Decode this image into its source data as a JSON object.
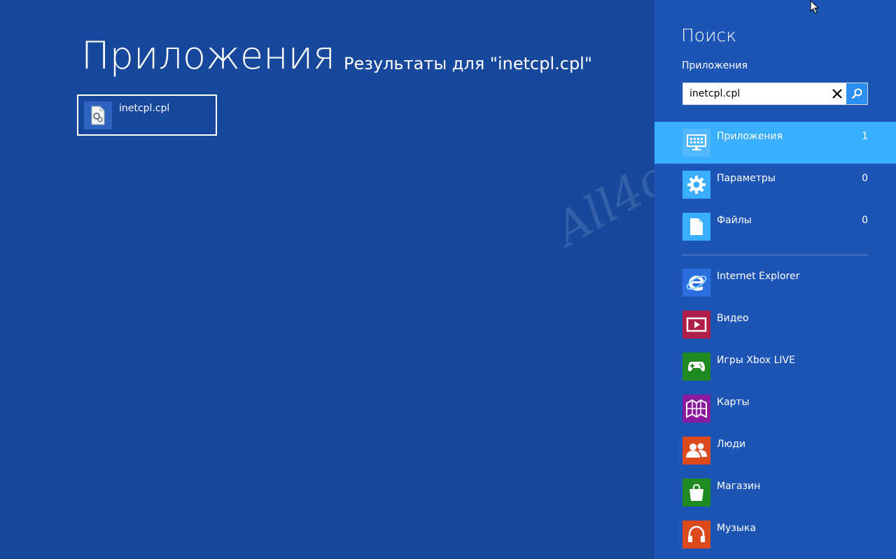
{
  "main": {
    "title": "Приложения",
    "results_label": "Результаты для \"inetcpl.cpl\"",
    "results": [
      {
        "name": "inetcpl.cpl",
        "icon": "control-panel-file-icon"
      }
    ]
  },
  "watermark": "All4os.Ru",
  "pane": {
    "title": "Поиск",
    "scope": "Приложения",
    "search": {
      "value": "inetcpl.cpl",
      "clear_icon": "close-icon",
      "search_icon": "search-icon"
    },
    "categories": [
      {
        "label": "Приложения",
        "count": "1",
        "icon": "apps-icon",
        "selected": true,
        "icon_bg": "#52b8ff"
      },
      {
        "label": "Параметры",
        "count": "0",
        "icon": "gear-icon",
        "selected": false,
        "icon_bg": "#3aaeff"
      },
      {
        "label": "Файлы",
        "count": "0",
        "icon": "file-icon",
        "selected": false,
        "icon_bg": "#3aaeff"
      }
    ],
    "apps": [
      {
        "label": "Internet Explorer",
        "icon": "internet-explorer-icon",
        "color": "#2a6ee0"
      },
      {
        "label": "Видео",
        "icon": "video-icon",
        "color": "#b01e4a"
      },
      {
        "label": "Игры Xbox LIVE",
        "icon": "xbox-icon",
        "color": "#1f8a1f"
      },
      {
        "label": "Карты",
        "icon": "maps-icon",
        "color": "#8b1b9e"
      },
      {
        "label": "Люди",
        "icon": "people-icon",
        "color": "#dc4a20"
      },
      {
        "label": "Магазин",
        "icon": "store-icon",
        "color": "#1f8a1f"
      },
      {
        "label": "Музыка",
        "icon": "music-icon",
        "color": "#dc4a20"
      }
    ]
  },
  "colors": {
    "background": "#17489c",
    "pane": "#1d55b6",
    "selected": "#3aaeff"
  }
}
